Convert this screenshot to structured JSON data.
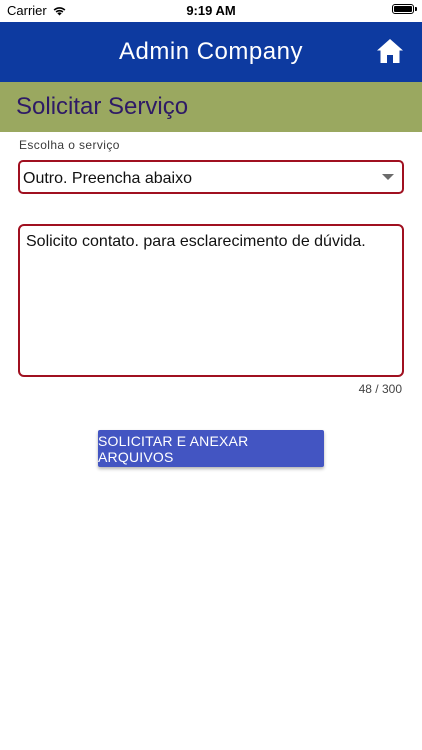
{
  "status_bar": {
    "carrier": "Carrier",
    "time": "9:19 AM",
    "wifi_icon": "wifi-icon",
    "battery_icon": "battery-icon"
  },
  "app_bar": {
    "title": "Admin Company",
    "home_icon": "home-icon",
    "background_color": "#0d3aa0"
  },
  "section": {
    "title": "Solicitar Serviço",
    "background_color": "#9aa860",
    "title_color": "#2e1a66"
  },
  "form": {
    "service_label": "Escolha o serviço",
    "service_selected": "Outro. Preencha abaixo",
    "message_text": "Solicito contato. para esclarecimento de dúvida.",
    "char_counter": "48 / 300",
    "border_color": "#a01020"
  },
  "actions": {
    "submit_label": "SOLICITAR E ANEXAR ARQUIVOS",
    "button_color": "#4355c2"
  }
}
